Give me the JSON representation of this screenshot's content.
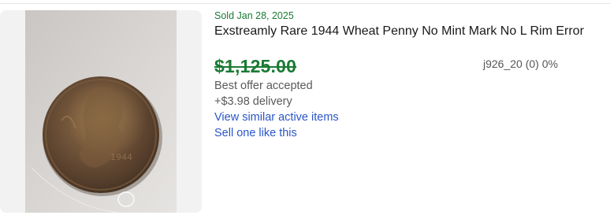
{
  "listing": {
    "sold_date": "Sold Jan 28, 2025",
    "title": "Exstreamly Rare 1944 Wheat Penny No Mint Mark No L Rim Error",
    "price": "$1,125.00",
    "best_offer": "Best offer accepted",
    "delivery": "+$3.98 delivery",
    "seller_info": "j926_20 (0) 0%",
    "view_similar_link": "View similar active items",
    "sell_one_link": "Sell one like this",
    "image_subject": "penny-coin-photo"
  },
  "colors": {
    "sold_green": "#1b7a34",
    "link_blue": "#2a55c7",
    "text_dark": "#191919",
    "text_muted": "#5a5a5a"
  }
}
